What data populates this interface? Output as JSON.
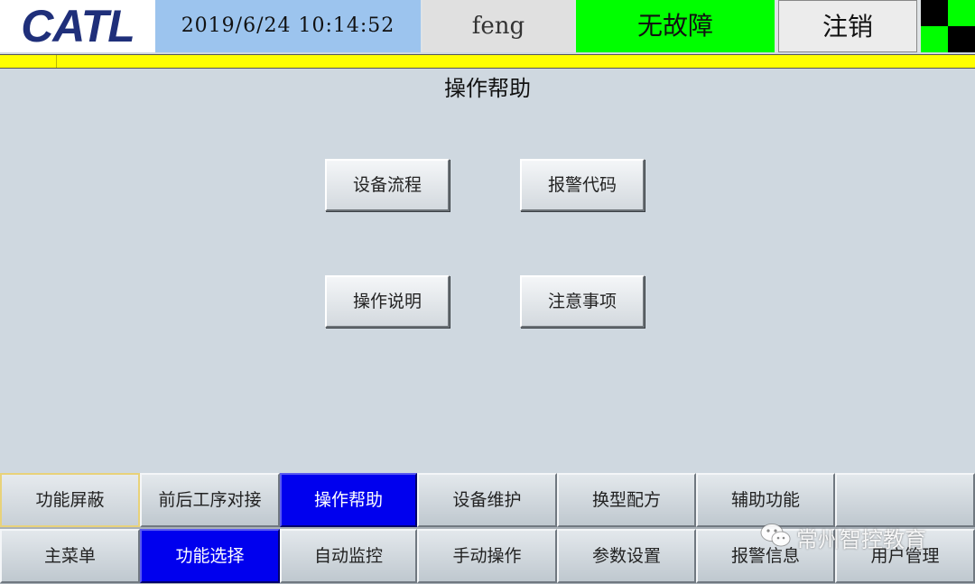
{
  "header": {
    "logo_text": "CATL",
    "datetime": "2019/6/24  10:14:52",
    "user": "feng",
    "fault_status": "无故障",
    "logout_label": "注销"
  },
  "colors": {
    "datetime_bg": "#9cc4ee",
    "fault_bg": "#00ff00",
    "alarm_bar": "#ffff00",
    "active_nav": "#0000ee",
    "logo_text": "#1f2f7a"
  },
  "main": {
    "title": "操作帮助",
    "buttons": {
      "equipment_flow": "设备流程",
      "alarm_code": "报警代码",
      "operation_manual": "操作说明",
      "precautions": "注意事项"
    }
  },
  "nav": {
    "row1": [
      "功能屏蔽",
      "前后工序对接",
      "操作帮助",
      "设备维护",
      "换型配方",
      "辅助功能",
      ""
    ],
    "row2": [
      "主菜单",
      "功能选择",
      "自动监控",
      "手动操作",
      "参数设置",
      "报警信息",
      "用户管理"
    ],
    "active_row1": "操作帮助",
    "active_row2": "功能选择"
  },
  "watermark": {
    "brand_text": "常州智控教育",
    "icon": "wechat-icon"
  }
}
